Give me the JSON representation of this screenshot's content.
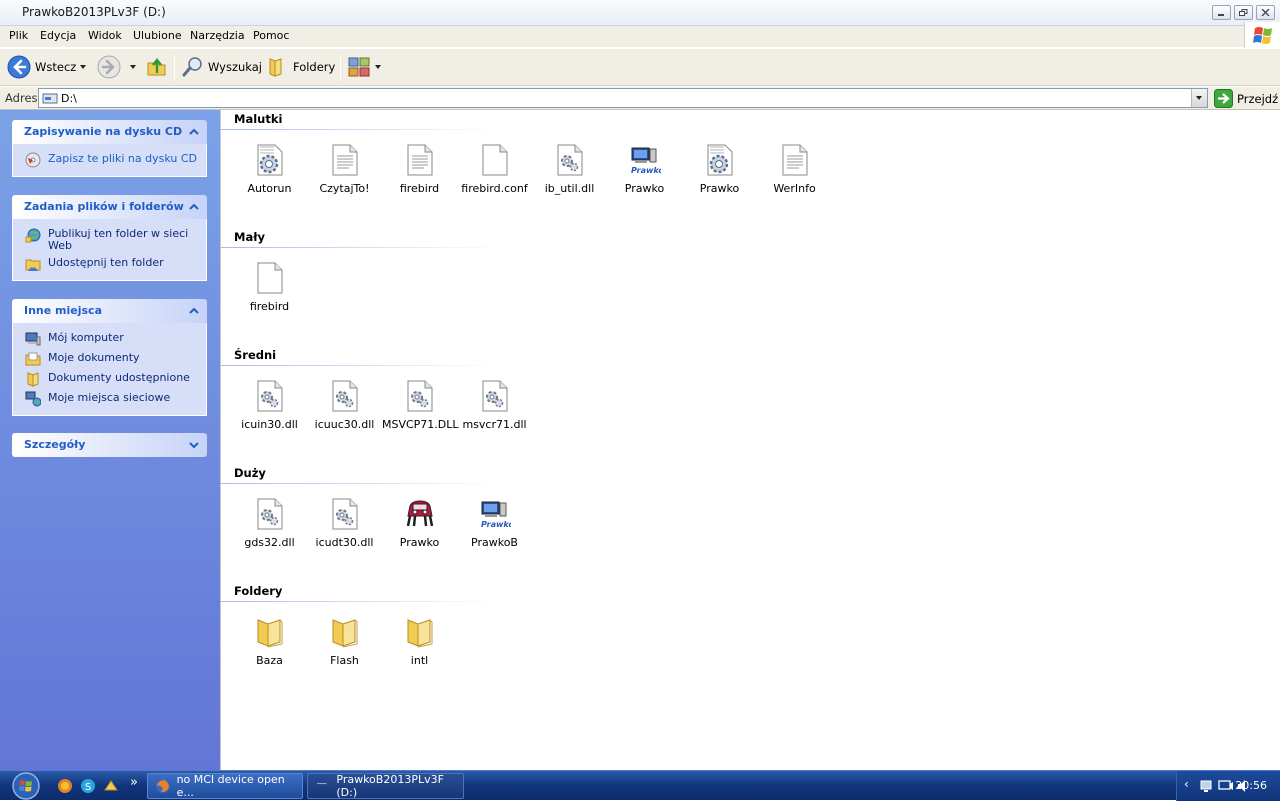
{
  "window": {
    "title": "PrawkoB2013PLv3F (D:)"
  },
  "menu": [
    "Plik",
    "Edycja",
    "Widok",
    "Ulubione",
    "Narzędzia",
    "Pomoc"
  ],
  "toolbar": {
    "back_label": "Wstecz",
    "search_label": "Wyszukaj",
    "folders_label": "Foldery"
  },
  "address": {
    "label": "Adres",
    "value": "D:\\",
    "go_label": "Przejdź"
  },
  "sidebar": {
    "cd": {
      "title": "Zapisywanie na dysku CD",
      "items": [
        {
          "label": "Zapisz te pliki na dysku CD",
          "icon": "cd-write-icon"
        }
      ]
    },
    "tasks": {
      "title": "Zadania plików i folderów",
      "items": [
        {
          "label": "Publikuj ten folder w sieci Web",
          "icon": "publish-web-icon"
        },
        {
          "label": "Udostępnij ten folder",
          "icon": "share-folder-icon"
        }
      ]
    },
    "places": {
      "title": "Inne miejsca",
      "items": [
        {
          "label": "Mój komputer",
          "icon": "my-computer-icon"
        },
        {
          "label": "Moje dokumenty",
          "icon": "my-documents-icon"
        },
        {
          "label": "Dokumenty udostępnione",
          "icon": "shared-documents-icon"
        },
        {
          "label": "Moje miejsca sieciowe",
          "icon": "network-places-icon"
        }
      ]
    },
    "details": {
      "title": "Szczegóły"
    }
  },
  "groups": [
    {
      "title": "Malutki",
      "files": [
        {
          "name": "Autorun",
          "icon": "config-file-icon"
        },
        {
          "name": "CzytajTo!",
          "icon": "text-file-icon"
        },
        {
          "name": "firebird",
          "icon": "text-file-icon"
        },
        {
          "name": "firebird.conf",
          "icon": "blank-file-icon"
        },
        {
          "name": "ib_util.dll",
          "icon": "dll-file-icon"
        },
        {
          "name": "Prawko",
          "icon": "prawko-app-icon"
        },
        {
          "name": "Prawko",
          "icon": "config-file-icon"
        },
        {
          "name": "WerInfo",
          "icon": "text-file-icon"
        }
      ]
    },
    {
      "title": "Mały",
      "files": [
        {
          "name": "firebird",
          "icon": "blank-file-icon"
        }
      ]
    },
    {
      "title": "Średni",
      "files": [
        {
          "name": "icuin30.dll",
          "icon": "dll-file-icon"
        },
        {
          "name": "icuuc30.dll",
          "icon": "dll-file-icon"
        },
        {
          "name": "MSVCP71.DLL",
          "icon": "dll-file-icon"
        },
        {
          "name": "msvcr71.dll",
          "icon": "dll-file-icon"
        }
      ]
    },
    {
      "title": "Duży",
      "files": [
        {
          "name": "gds32.dll",
          "icon": "dll-file-icon"
        },
        {
          "name": "icudt30.dll",
          "icon": "dll-file-icon"
        },
        {
          "name": "Prawko",
          "icon": "car-app-icon"
        },
        {
          "name": "PrawkoB",
          "icon": "prawko-app-icon"
        }
      ]
    },
    {
      "title": "Foldery",
      "files": [
        {
          "name": "Baza",
          "icon": "folder-icon"
        },
        {
          "name": "Flash",
          "icon": "folder-icon"
        },
        {
          "name": "intl",
          "icon": "folder-icon"
        }
      ]
    }
  ],
  "taskbar": {
    "tasks": [
      {
        "label": "no MCI device open e...",
        "icon": "firefox-icon"
      },
      {
        "label": "PrawkoB2013PLv3F (D:)",
        "icon": "explorer-folder-icon"
      }
    ],
    "clock": "20:56"
  },
  "colors": {
    "sidebar_top": "#7ba2e7",
    "sidebar_bottom": "#6375d6",
    "panel_title": "#215dc6",
    "taskbar": "#10357c"
  }
}
